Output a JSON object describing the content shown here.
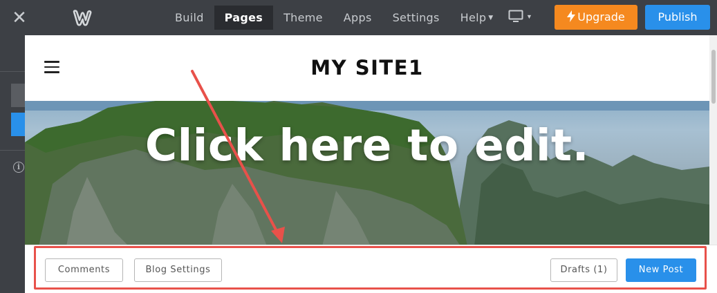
{
  "topbar": {
    "close_icon": "close-icon",
    "logo_icon": "weebly-logo-icon",
    "nav": [
      {
        "label": "Build",
        "active": false
      },
      {
        "label": "Pages",
        "active": true
      },
      {
        "label": "Theme",
        "active": false
      },
      {
        "label": "Apps",
        "active": false
      },
      {
        "label": "Settings",
        "active": false
      },
      {
        "label": "Help",
        "active": false,
        "dropdown": true
      }
    ],
    "device_icon": "desktop-monitor-icon",
    "upgrade_label": "Upgrade",
    "upgrade_icon": "lightning-bolt-icon",
    "publish_label": "Publish",
    "colors": {
      "bar": "#3d4045",
      "upgrade": "#f5891f",
      "publish": "#2990ea"
    }
  },
  "sidebar": {
    "info_icon": "info-icon",
    "info_glyph": "i"
  },
  "site": {
    "menu_icon": "hamburger-menu-icon",
    "title": "MY SITE1",
    "hero_text": "Click here to edit."
  },
  "blog_bar": {
    "comments_label": "Comments",
    "blog_settings_label": "Blog Settings",
    "drafts_label": "Drafts (1)",
    "new_post_label": "New Post",
    "highlight_color": "#e8514a"
  }
}
